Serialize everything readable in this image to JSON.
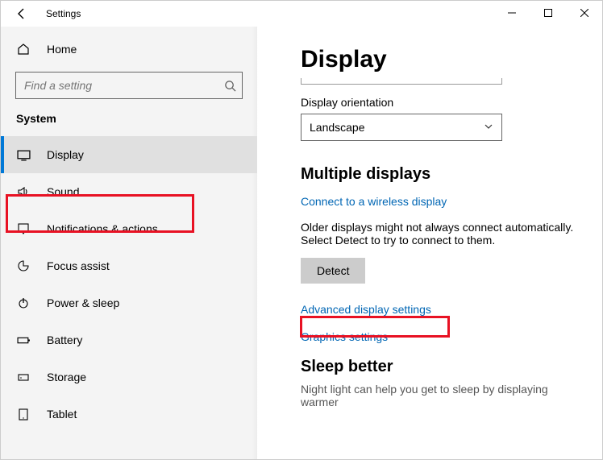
{
  "window": {
    "title": "Settings"
  },
  "sidebar": {
    "home": "Home",
    "search_placeholder": "Find a setting",
    "section": "System",
    "items": [
      {
        "label": "Display"
      },
      {
        "label": "Sound"
      },
      {
        "label": "Notifications & actions"
      },
      {
        "label": "Focus assist"
      },
      {
        "label": "Power & sleep"
      },
      {
        "label": "Battery"
      },
      {
        "label": "Storage"
      },
      {
        "label": "Tablet"
      }
    ]
  },
  "main": {
    "title": "Display",
    "orientation_label": "Display orientation",
    "orientation_value": "Landscape",
    "multi_title": "Multiple displays",
    "link_wireless": "Connect to a wireless display",
    "multi_desc": "Older displays might not always connect automatically. Select Detect to try to connect to them.",
    "detect_label": "Detect",
    "link_advanced": "Advanced display settings",
    "link_graphics": "Graphics settings",
    "sleep_title": "Sleep better",
    "sleep_desc": "Night light can help you get to sleep by displaying warmer"
  }
}
